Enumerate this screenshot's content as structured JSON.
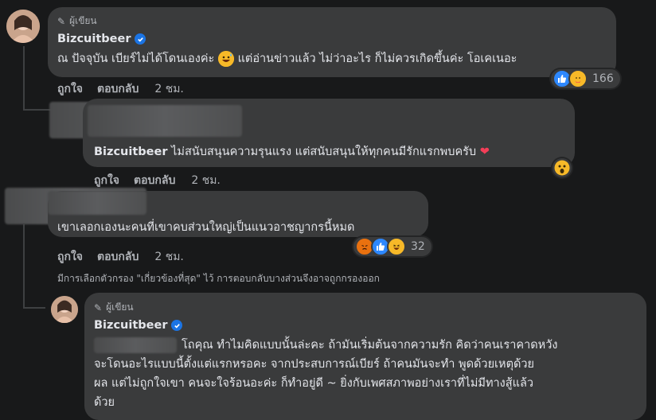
{
  "comments": [
    {
      "author_badge": "ผู้เขียน",
      "author": "Bizcuitbeer",
      "text_part1": "ณ ปัจจุบัน เบียร์ไม่ได้โดนเองค่ะ",
      "text_part2": "แต่อ่านข่าวแล้ว ไม่ว่าอะไร ก็ไม่ควรเกิดขึ้นค่ะ โอเคเนอะ",
      "reactions": [
        "like-icon",
        "care-icon"
      ],
      "reaction_count": "166",
      "like": "ถูกใจ",
      "reply": "ตอบกลับ",
      "time": "2 ชม."
    },
    {
      "author": "Bizcuitbeer",
      "text": "ไม่สนับสนุนความรุนแรง แต่สนับสนุนให้ทุกคนมีรักแรกพบครับ",
      "like": "ถูกใจ",
      "reply": "ตอบกลับ",
      "time": "2 ชม."
    },
    {
      "text": "เขาเลอกเองนะคนที่เขาคบส่วนใหญ่เป็นแนวอาชญากรนี้หมด",
      "reactions": [
        "angry-icon",
        "like-icon",
        "haha-icon"
      ],
      "reaction_count": "32",
      "like": "ถูกใจ",
      "reply": "ตอบกลับ",
      "time": "2 ชม."
    },
    {
      "author_badge": "ผู้เขียน",
      "author": "Bizcuitbeer",
      "lines": [
        "โถคุณ ทำไมคิดแบบนั้นล่ะคะ ถ้ามันเริ่มต้นจากความรัก คิดว่าคนเราคาดหวัง",
        "จะโดนอะไรแบบนี้ตั้งแต่แรกหรอคะ จากประสบการณ์เบียร์ ถ้าคนมันจะทำ พูดด้วยเหตุด้วย",
        "ผล แต่ไม่ถูกใจเขา คนจะใจร้อนอะค่ะ ก็ทำอยู่ดี ~ ยิ่งกับเพศสภาพอย่างเราที่ไม่มีทางสู้แล้ว",
        "ด้วย"
      ]
    }
  ],
  "filter_note": "มีการเลือกตัวกรอง \"เกี่ยวข้องที่สุด\" ไว้ การตอบกลับบางส่วนจึงอาจถูกกรองออก",
  "colors": {
    "bg": "#18191a",
    "bubble": "#3a3b3c",
    "muted": "#b0b3b8",
    "like_blue": "#2d88ff"
  }
}
